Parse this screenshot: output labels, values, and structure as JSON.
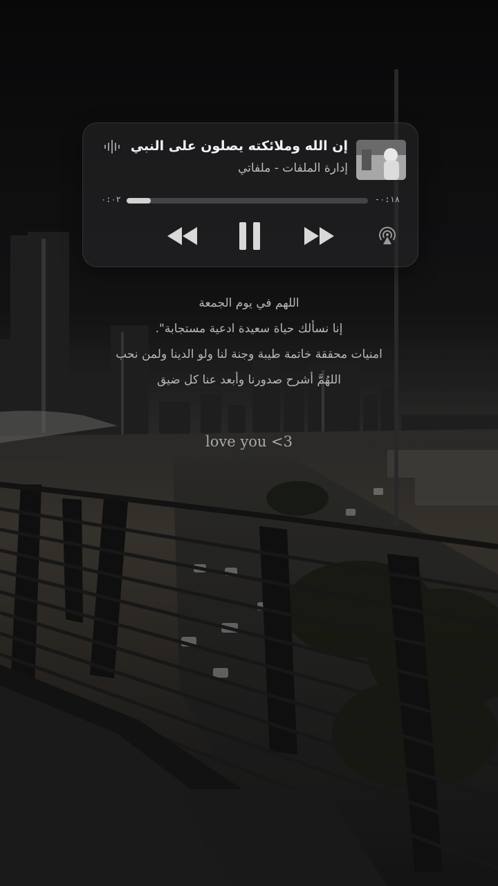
{
  "player": {
    "title": "إن الله وملائكته يصلون على النبي",
    "subtitle": "إدارة الملفات - ملفاتي",
    "elapsed": "٠:٠٢",
    "remaining": "-٠:١٨",
    "progress_fraction": 0.1,
    "icons": {
      "wave": "waveform-icon",
      "prev": "rewind-icon",
      "play": "pause-icon",
      "next": "fast-forward-icon",
      "airplay": "airplay-audio-icon"
    }
  },
  "lyrics": [
    "اللهم في يوم الجمعة",
    "إنا نسألك حياة سعيدة ادعية مستجابة\".",
    "امنيات محققة خاتمة طيبة وجنة لنا ولو الدينا ولمن نحب",
    "اللهُمَّ أشرح صدورنا وأبعد عنا كل ضيق"
  ],
  "caption": "love you <3",
  "colors": {
    "panel": "#2a2a2c",
    "text": "#f2f2f2",
    "muted": "#bdbdbd"
  }
}
